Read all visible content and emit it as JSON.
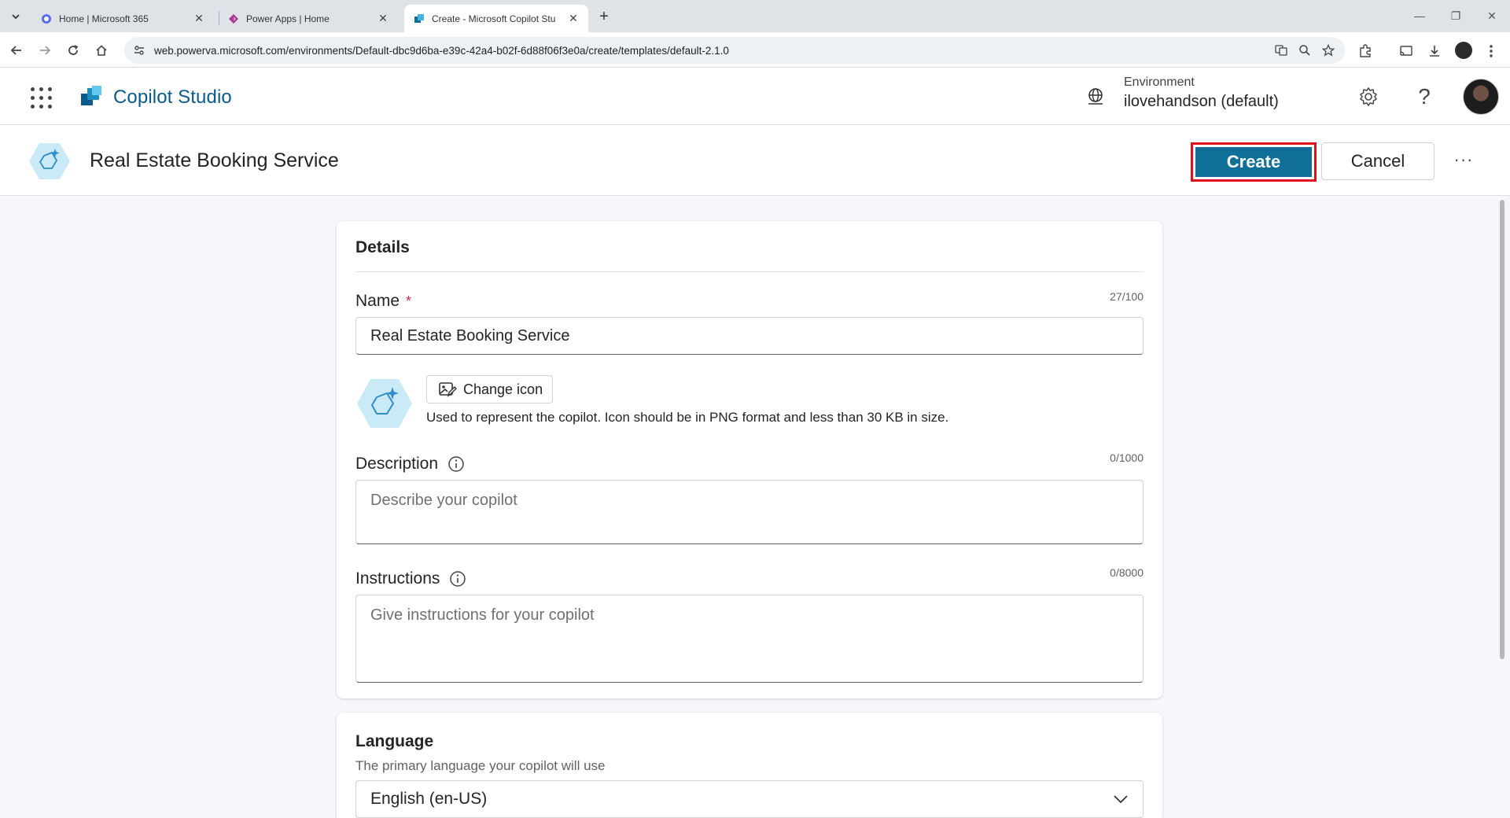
{
  "browser": {
    "tabs": [
      {
        "title": "Home | Microsoft 365",
        "active": false
      },
      {
        "title": "Power Apps | Home",
        "active": false
      },
      {
        "title": "Create - Microsoft Copilot Stu",
        "active": true
      }
    ],
    "url": "web.powerva.microsoft.com/environments/Default-dbc9d6ba-e39c-42a4-b02f-6d88f06f3e0a/create/templates/default-2.1.0"
  },
  "app": {
    "name": "Copilot Studio",
    "environment_label": "Environment",
    "environment_value": "ilovehandson (default)"
  },
  "command_bar": {
    "title": "Real Estate Booking Service",
    "create_label": "Create",
    "cancel_label": "Cancel",
    "more_label": "···"
  },
  "details": {
    "section_title": "Details",
    "name_label": "Name",
    "name_required": "*",
    "name_counter": "27/100",
    "name_value": "Real Estate Booking Service",
    "change_icon_label": "Change icon",
    "icon_hint": "Used to represent the copilot. Icon should be in PNG format and less than 30 KB in size.",
    "description_label": "Description",
    "description_counter": "0/1000",
    "description_placeholder": "Describe your copilot",
    "instructions_label": "Instructions",
    "instructions_counter": "0/8000",
    "instructions_placeholder": "Give instructions for your copilot"
  },
  "language": {
    "section_title": "Language",
    "subtitle": "The primary language your copilot will use",
    "selected": "English (en-US)"
  },
  "colors": {
    "accent": "#0f6f96",
    "brand_text": "#0b5a8a",
    "highlight_border": "#e0101d",
    "required": "#c4314b"
  }
}
